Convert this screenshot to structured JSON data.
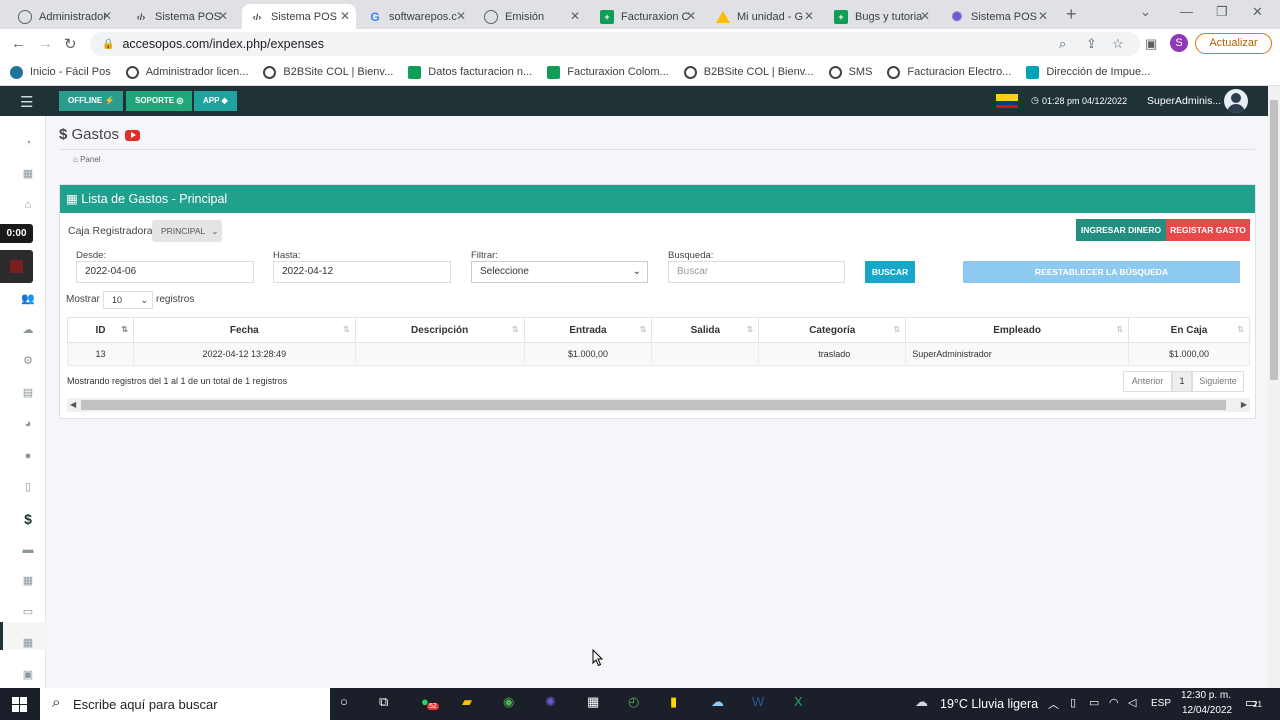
{
  "browser": {
    "tabs": [
      {
        "label": "Administrador",
        "icon": "globe-icon",
        "color": "#5f6368"
      },
      {
        "label": "Sistema POS",
        "icon": "code-icon",
        "color": "#202124"
      },
      {
        "label": "Sistema POS",
        "icon": "code-icon",
        "color": "#202124",
        "active": true
      },
      {
        "label": "softwarepos.c",
        "icon": "google-icon",
        "color": "#4285f4"
      },
      {
        "label": "Emisión",
        "icon": "globe-icon",
        "color": "#5f6368"
      },
      {
        "label": "Facturaxion C",
        "icon": "sheets-icon",
        "color": "#0f9d58"
      },
      {
        "label": "Mi unidad - G",
        "icon": "drive-icon",
        "color": "#fbbc04"
      },
      {
        "label": "Bugs y tutoria",
        "icon": "sheets-icon",
        "color": "#0f9d58"
      },
      {
        "label": "Sistema POS",
        "icon": "gear-icon",
        "color": "#6a5acd"
      }
    ],
    "url": "accesopos.com/index.php/expenses",
    "profile_initial": "S",
    "update_label": "Actualizar",
    "bookmarks": [
      {
        "label": "Inicio - Fácil Pos",
        "color": "#21759b"
      },
      {
        "label": "Administrador licen...",
        "color": "#444"
      },
      {
        "label": "B2BSite COL | Bienv...",
        "color": "#444"
      },
      {
        "label": "Datos facturacion n...",
        "color": "#0f9d58"
      },
      {
        "label": "Facturaxion Colom...",
        "color": "#0f9d58"
      },
      {
        "label": "B2BSite COL | Bienv...",
        "color": "#444"
      },
      {
        "label": "SMS",
        "color": "#444"
      },
      {
        "label": "Facturacion Electro...",
        "color": "#444"
      },
      {
        "label": "Dirección de Impue...",
        "color": "#00a3b4"
      }
    ]
  },
  "topbar": {
    "offline_label": "OFFLINE",
    "soporte_label": "SOPORTE",
    "app_label": "APP",
    "datetime": "01:28 pm 04/12/2022",
    "user": "SuperAdminis...",
    "colors": {
      "bar": "#1f3236",
      "offline": "#2a9d8f",
      "soporte": "#1fa77a",
      "app": "#20a39e"
    }
  },
  "sidebar": {
    "timer": "0:00"
  },
  "page": {
    "title": "Gastos",
    "breadcrumb": "Panel",
    "panel_title": "Lista de Gastos - Principal",
    "caja_label": "Caja Registradora:",
    "caja_value": "PRINCIPAL",
    "ingresar_label": "INGRESAR DINERO",
    "registrar_label": "REGISTAR GASTO",
    "desde_label": "Desde:",
    "desde_value": "2022-04-06",
    "hasta_label": "Hasta:",
    "hasta_value": "2022-04-12",
    "filtrar_label": "Filtrar:",
    "filtrar_value": "Seleccione",
    "busqueda_label": "Busqueda:",
    "busqueda_placeholder": "Buscar",
    "buscar_label": "BUSCAR",
    "reset_label": "REESTABLECER LA BÚSQUEDA",
    "mostrar_label": "Mostrar",
    "mostrar_value": "10",
    "registros_label": "registros",
    "table": {
      "headers": [
        "ID",
        "Fecha",
        "Descripción",
        "Entrada",
        "Salida",
        "Categoría",
        "Empleado",
        "En Caja"
      ],
      "rows": [
        [
          "13",
          "2022-04-12 13:28:49",
          "",
          "$1.000,00",
          "",
          "traslado",
          "SuperAdministrador",
          "$1.000,00"
        ]
      ]
    },
    "info": "Mostrando registros del 1 al 1 de un total de 1 registros",
    "pager": {
      "prev": "Anterior",
      "current": "1",
      "next": "Siguiente"
    }
  },
  "taskbar": {
    "search_placeholder": "Escribe aquí para buscar",
    "weather": "19°C  Lluvia ligera",
    "lang": "ESP",
    "time": "12:30 p. m.",
    "date": "12/04/2022",
    "notifications": "21",
    "whatsapp_badge": "52"
  }
}
